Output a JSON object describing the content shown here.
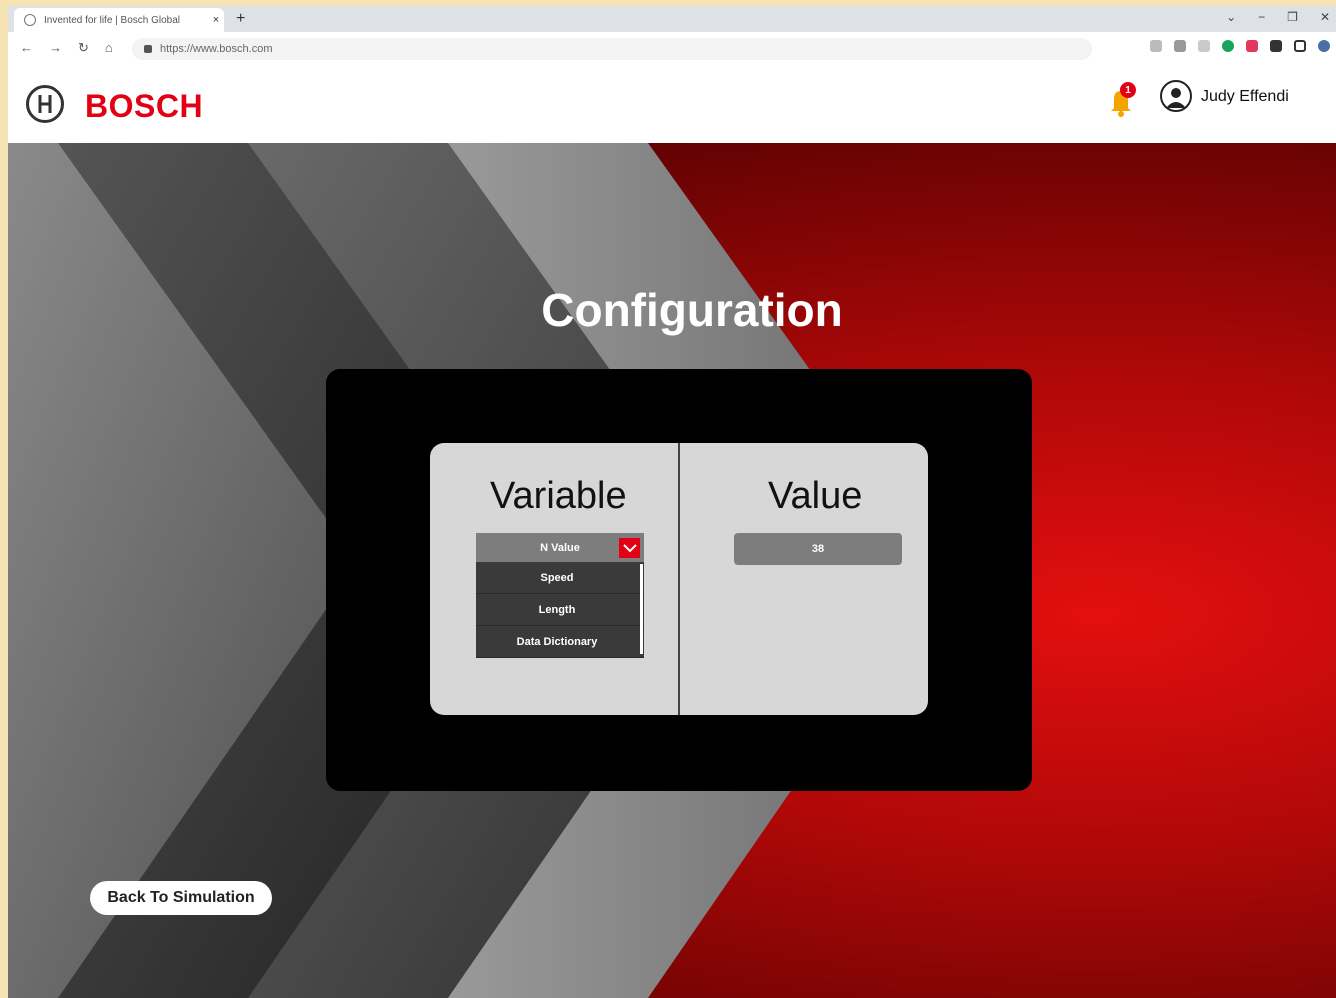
{
  "browser": {
    "tab_title": "Invented for life | Bosch Global",
    "tab_close": "×",
    "new_tab": "+",
    "url": "https://www.bosch.com",
    "nav": {
      "back": "←",
      "forward": "→",
      "reload": "↻",
      "home": "⌂"
    },
    "window": {
      "minimize": "−",
      "restore": "❐",
      "close": "✕",
      "tab_search": "⌄"
    }
  },
  "header": {
    "brand": "BOSCH",
    "notification_count": "1",
    "user_name": "Judy Effendi"
  },
  "page": {
    "title": "Configuration",
    "variable_heading": "Variable",
    "value_heading": "Value",
    "dropdown": {
      "selected": "N Value",
      "options": [
        "Speed",
        "Length",
        "Data Dictionary"
      ]
    },
    "value": "38",
    "back_button": "Back To Simulation"
  },
  "colors": {
    "brand_red": "#e20015",
    "panel": "#000000",
    "card": "#d7d7d7"
  },
  "icons": [
    "globe-icon",
    "lock-icon",
    "bell-icon",
    "user-icon",
    "chevron-down-icon",
    "bosch-logo-icon"
  ]
}
